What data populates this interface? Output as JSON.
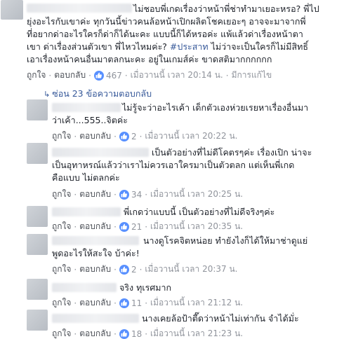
{
  "main_comment": {
    "text": "ไม่ชอบพี่เกดเรื่องว่าหน้าพี่ช่าทำมาเยอะหรอ? พี่ไป ยุ่งอะไรกับเขาค่ะ ทุกวันนี้ข่าวคนล้อหน้าเปิกผลิตโชคเยอะๆ อาจจะมาจากพี่ ที่อยากด่าอะไรใครก็ด่าก็ได้นะคะ แบบนี้ก็ได้หรอค่ะ แพ้แล้วด่าเรื่องหน้าตา เขา ด่าเรื่องส่วนตัวเขา พี่ไหวไหมค่ะ?",
    "line1": "ไม่ชอบพี่เกดเรื่องว่าหน้าพี่ช่าทำมาเยอะหรอ? พี่ไป",
    "line2": "ยุ่งอะไรกับเขาค่ะ ทุกวันนี้ข่าวคนล้อหน้าเปิกผลิตโชคเยอะๆ อาจจะมาจากพี่",
    "line3": "ที่อยากด่าอะไรใครก็ด่าก็ได้นะคะ แบบนี้ก็ได้หรอค่ะ แพ้แล้วด่าเรื่องหน้าตา",
    "line4_pre": "เขา ด่าเรื่องส่วนตัวเขา พี่ไหวไหมค่ะ? ",
    "hashtag": "#ประสาท",
    "line4_post": " ไม่ว่าจะเป็นใครก็ไม่มีสิทธิ์",
    "line5": "เอาเรื่องหน้าคนอื่นมาตลกนะคะ อยู่ในเกมส์ค่ะ ขาดสติมากกกกกก",
    "like_label": "ถูกใจ",
    "reply_label": "ตอบกลับ",
    "likes": "467",
    "time": "เมื่อวานนี้ เวลา 20:14 น.",
    "edited": "มีการแก้ไข"
  },
  "replies_toggle": "ซ่อน 23 ข้อความตอบกลับ",
  "replies": [
    {
      "line1": "ไม่รู้จะว่าอะไรเค้า เด็กตัวเองห่วยเรยหาเรื่องอื่นมา",
      "line2": "ว่าเค้า...555..จิตค่ะ",
      "likes": "2",
      "time": "เมื่อวานนี้ เวลา 20:22 น."
    },
    {
      "line1": "เป็นตัวอย่างที่ไม่ดีโคตรๆค่ะ เรื่องเปิก น่าจะ",
      "line2": "เป็นอุทาหรณ์แล้วว่าเราไม่ควรเอาใครมาเป็นตัวตลก แต่เห็นพี่เกด",
      "line3": "คือแบบ ไม่ตลกค่ะ",
      "likes": "34",
      "time": "เมื่อวานนี้ เวลา 20:25 น."
    },
    {
      "line1": "พี่เกดว่าแบบนี้ เป็นตัวอย่างที่ไม่ดีจริงๆค่ะ",
      "likes": "21",
      "time": "เมื่อวานนี้ เวลา 20:35 น."
    },
    {
      "line1": "นางดูโรคจิตหน่อย ทำยังไงก็ได้ให้มาช่าดูแย่",
      "line2": "พูดอะไรให้สะใจ บ้าค่ะ!",
      "likes": "2",
      "time": "เมื่อวานนี้ เวลา 20:37 น."
    },
    {
      "line1": "จริง ทุเรศมาก",
      "likes": "11",
      "time": "เมื่อวานนี้ เวลา 21:12 น."
    },
    {
      "line1": "นางเคยล้อป้าตี๊ดว่าหน้าไม่เท่ากัน จำได้มั่ะ",
      "likes": "18",
      "time": "เมื่อวานนี้ เวลา 21:23 น."
    }
  ],
  "labels": {
    "like": "ถูกใจ",
    "reply": "ตอบกลับ"
  }
}
